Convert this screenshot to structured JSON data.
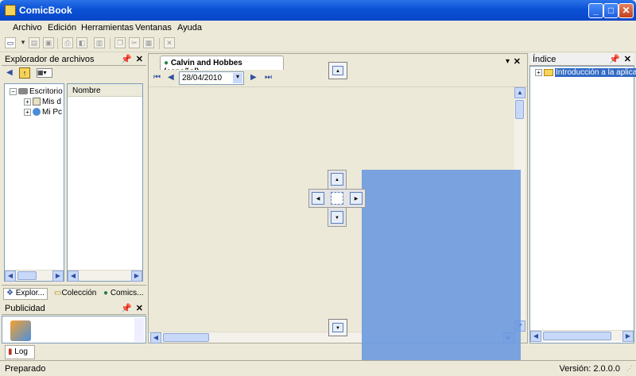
{
  "window": {
    "title": "ComicBook"
  },
  "menu": [
    "Archivo",
    "Edición",
    "Herramientas",
    "Ventanas",
    "Ayuda"
  ],
  "explorer": {
    "title": "Explorador de archivos",
    "tree": [
      {
        "label": "Escritorio",
        "expand": "−"
      },
      {
        "label": "Mis d",
        "expand": "+"
      },
      {
        "label": "Mi Pc",
        "expand": "+"
      }
    ],
    "column_header": "Nombre",
    "tabs": [
      "Explor...",
      "Colección",
      "Comics..."
    ]
  },
  "ads": {
    "title": "Publicidad"
  },
  "log_tab": "Log",
  "document": {
    "tab_title": "Calvin and Hobbes (español)",
    "date": "28/04/2010"
  },
  "index": {
    "title": "Índice",
    "items": [
      "Introducción a la aplicac"
    ]
  },
  "status": {
    "left": "Preparado",
    "right": "Versión: 2.0.0.0"
  },
  "colors": {
    "titlebar": "#0A52D6",
    "dock_overlay": "#6F9BDE",
    "chrome": "#ECE9D8"
  }
}
